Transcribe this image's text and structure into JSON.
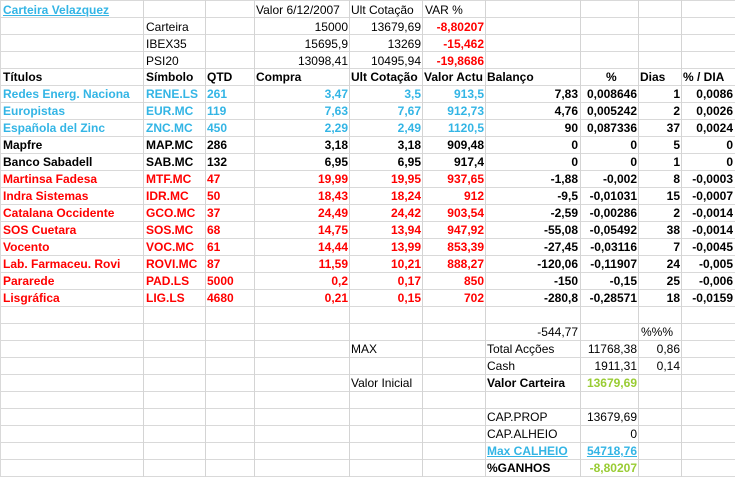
{
  "title": "Carteira Velazquez",
  "summary": {
    "headers": [
      "Valor 6/12/2007",
      "Ult Cotação",
      "VAR %"
    ],
    "rows": [
      {
        "label": "Carteira",
        "valor": "15000",
        "ult": "13679,69",
        "var": "-8,80207"
      },
      {
        "label": "IBEX35",
        "valor": "15695,9",
        "ult": "13269",
        "var": "-15,462"
      },
      {
        "label": "PSI20",
        "valor": "13098,41",
        "ult": "10495,94",
        "var": "-19,8686"
      }
    ]
  },
  "table": {
    "headers": [
      "Títulos",
      "Símbolo",
      "QTD",
      "Compra",
      "Ult Cotação",
      "Valor Actu",
      "Balanço",
      "%",
      "Dias",
      "% / DIA"
    ],
    "rows": [
      {
        "titulo": "Redes Energ. Naciona",
        "simbolo": "RENE.LS",
        "qtd": "261",
        "compra": "3,47",
        "ult": "3,5",
        "valor": "913,5",
        "balanco": "7,83",
        "pct": "0,008646",
        "dias": "1",
        "pctdia": "0,0086",
        "color": "blue"
      },
      {
        "titulo": "Europistas",
        "simbolo": "EUR.MC",
        "qtd": "119",
        "compra": "7,63",
        "ult": "7,67",
        "valor": "912,73",
        "balanco": "4,76",
        "pct": "0,005242",
        "dias": "2",
        "pctdia": "0,0026",
        "color": "blue"
      },
      {
        "titulo": "Española del Zinc",
        "simbolo": "ZNC.MC",
        "qtd": "450",
        "compra": "2,29",
        "ult": "2,49",
        "valor": "1120,5",
        "balanco": "90",
        "pct": "0,087336",
        "dias": "37",
        "pctdia": "0,0024",
        "color": "blue"
      },
      {
        "titulo": "Mapfre",
        "simbolo": "MAP.MC",
        "qtd": "286",
        "compra": "3,18",
        "ult": "3,18",
        "valor": "909,48",
        "balanco": "0",
        "pct": "0",
        "dias": "5",
        "pctdia": "0",
        "color": "black"
      },
      {
        "titulo": "Banco Sabadell",
        "simbolo": "SAB.MC",
        "qtd": "132",
        "compra": "6,95",
        "ult": "6,95",
        "valor": "917,4",
        "balanco": "0",
        "pct": "0",
        "dias": "1",
        "pctdia": "0",
        "color": "black"
      },
      {
        "titulo": "Martinsa Fadesa",
        "simbolo": "MTF.MC",
        "qtd": "47",
        "compra": "19,99",
        "ult": "19,95",
        "valor": "937,65",
        "balanco": "-1,88",
        "pct": "-0,002",
        "dias": "8",
        "pctdia": "-0,0003",
        "color": "red"
      },
      {
        "titulo": "Indra Sistemas",
        "simbolo": "IDR.MC",
        "qtd": "50",
        "compra": "18,43",
        "ult": "18,24",
        "valor": "912",
        "balanco": "-9,5",
        "pct": "-0,01031",
        "dias": "15",
        "pctdia": "-0,0007",
        "color": "red"
      },
      {
        "titulo": "Catalana Occidente",
        "simbolo": "GCO.MC",
        "qtd": "37",
        "compra": "24,49",
        "ult": "24,42",
        "valor": "903,54",
        "balanco": "-2,59",
        "pct": "-0,00286",
        "dias": "2",
        "pctdia": "-0,0014",
        "color": "red"
      },
      {
        "titulo": "SOS Cuetara",
        "simbolo": "SOS.MC",
        "qtd": "68",
        "compra": "14,75",
        "ult": "13,94",
        "valor": "947,92",
        "balanco": "-55,08",
        "pct": "-0,05492",
        "dias": "38",
        "pctdia": "-0,0014",
        "color": "red"
      },
      {
        "titulo": "Vocento",
        "simbolo": "VOC.MC",
        "qtd": "61",
        "compra": "14,44",
        "ult": "13,99",
        "valor": "853,39",
        "balanco": "-27,45",
        "pct": "-0,03116",
        "dias": "7",
        "pctdia": "-0,0045",
        "color": "red"
      },
      {
        "titulo": "Lab. Farmaceu. Rovi",
        "simbolo": "ROVI.MC",
        "qtd": "87",
        "compra": "11,59",
        "ult": "10,21",
        "valor": "888,27",
        "balanco": "-120,06",
        "pct": "-0,11907",
        "dias": "24",
        "pctdia": "-0,005",
        "color": "red"
      },
      {
        "titulo": "Pararede",
        "simbolo": "PAD.LS",
        "qtd": "5000",
        "compra": "0,2",
        "ult": "0,17",
        "valor": "850",
        "balanco": "-150",
        "pct": "-0,15",
        "dias": "25",
        "pctdia": "-0,006",
        "color": "red"
      },
      {
        "titulo": "Lisgráfica",
        "simbolo": "LIG.LS",
        "qtd": "4680",
        "compra": "0,21",
        "ult": "0,15",
        "valor": "702",
        "balanco": "-280,8",
        "pct": "-0,28571",
        "dias": "18",
        "pctdia": "-0,0159",
        "color": "red"
      }
    ]
  },
  "totals": {
    "balanco_total": "-544,77",
    "pct_header": "%%%",
    "max_label": "MAX",
    "total_accoes_label": "Total Acções",
    "total_accoes": "11768,38",
    "total_accoes_pct": "0,86",
    "cash_label": "Cash",
    "cash": "1911,31",
    "cash_pct": "0,14",
    "valor_inicial_label": "Valor Inicial",
    "valor_carteira_label": "Valor Carteira",
    "valor_carteira": "13679,69",
    "cap_prop_label": "CAP.PROP",
    "cap_prop": "13679,69",
    "cap_alheio_label": "CAP.ALHEIO",
    "cap_alheio": "0",
    "max_calheio_label": "Max CALHEIO",
    "max_calheio": "54718,76",
    "ganhos_label": "%GANHOS",
    "ganhos": "-8,80207"
  },
  "colors": {
    "blue": "#33b5e5",
    "red": "#ff0000",
    "green": "#99cc33",
    "grid": "#d9d9d9"
  }
}
